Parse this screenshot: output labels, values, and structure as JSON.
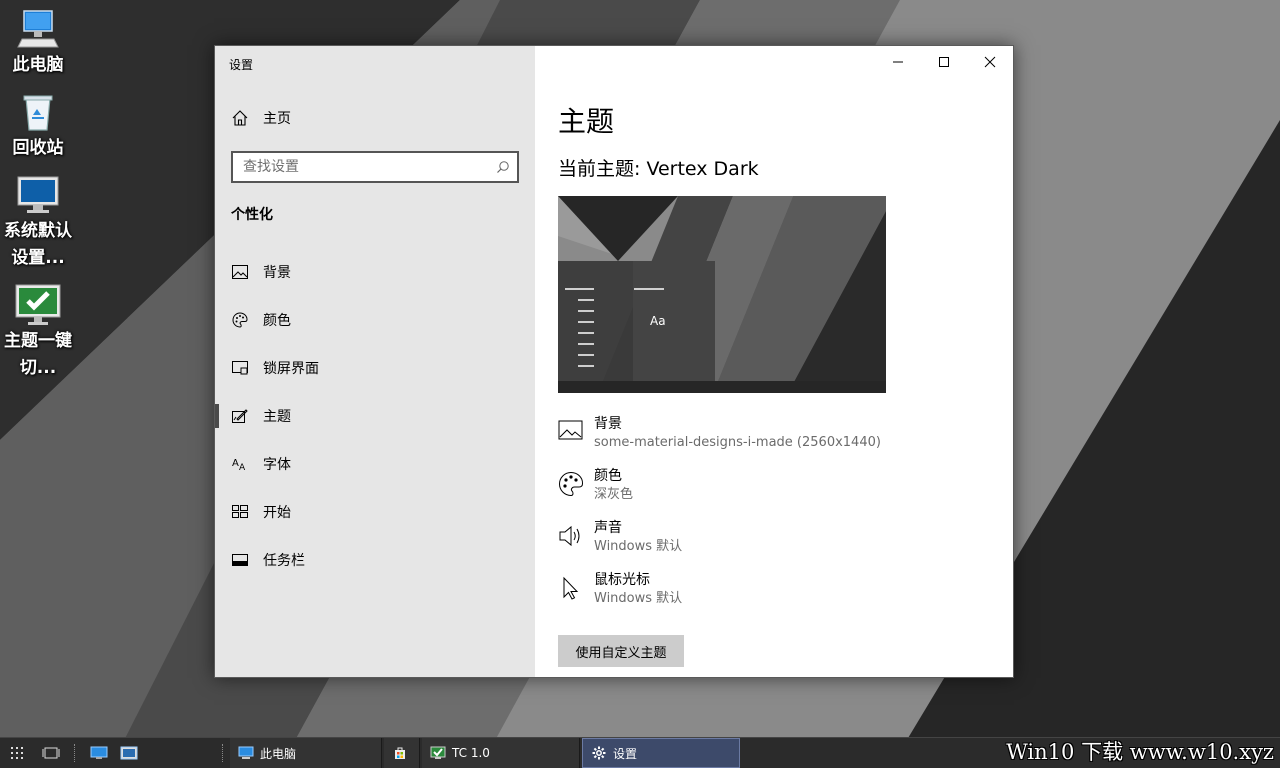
{
  "desktop": {
    "icons": [
      {
        "label": "此电脑",
        "icon": "computer-icon"
      },
      {
        "label": "回收站",
        "icon": "recycle-bin-icon"
      },
      {
        "label": "系统默认设置...",
        "icon": "monitor-icon"
      },
      {
        "label": "主题一键切...",
        "icon": "theme-switch-icon"
      }
    ]
  },
  "window": {
    "title": "设置",
    "nav": {
      "home": "主页",
      "search_placeholder": "查找设置",
      "section": "个性化",
      "items": [
        {
          "label": "背景",
          "icon": "picture-icon",
          "active": false
        },
        {
          "label": "颜色",
          "icon": "palette-icon",
          "active": false
        },
        {
          "label": "锁屏界面",
          "icon": "lock-screen-icon",
          "active": false
        },
        {
          "label": "主题",
          "icon": "theme-icon",
          "active": true
        },
        {
          "label": "字体",
          "icon": "font-icon",
          "active": false
        },
        {
          "label": "开始",
          "icon": "start-icon",
          "active": false
        },
        {
          "label": "任务栏",
          "icon": "taskbar-icon",
          "active": false
        }
      ]
    },
    "content": {
      "title": "主题",
      "current_theme": "当前主题: Vertex Dark",
      "preview_text": "Aa",
      "properties": [
        {
          "name": "背景",
          "value": "some-material-designs-i-made (2560x1440)",
          "icon": "picture-icon"
        },
        {
          "name": "颜色",
          "value": "深灰色",
          "icon": "palette-icon"
        },
        {
          "name": "声音",
          "value": "Windows 默认",
          "icon": "speaker-icon"
        },
        {
          "name": "鼠标光标",
          "value": "Windows 默认",
          "icon": "cursor-icon"
        }
      ],
      "custom_button": "使用自定义主题"
    }
  },
  "taskbar": {
    "items": [
      {
        "label": "此电脑",
        "icon": "computer-icon",
        "active": false
      },
      {
        "label": "",
        "icon": "store-icon",
        "active": false
      },
      {
        "label": "TC 1.0",
        "icon": "tc-icon",
        "active": false
      },
      {
        "label": "设置",
        "icon": "gear-icon",
        "active": true
      }
    ]
  },
  "watermark": "Win10 下载 www.w10.xyz",
  "colors": {
    "nav_bg": "#e6e6e6",
    "content_bg": "#ffffff",
    "taskbar_bg": "#2b2b2b",
    "active_task": "#3d4a6a"
  }
}
